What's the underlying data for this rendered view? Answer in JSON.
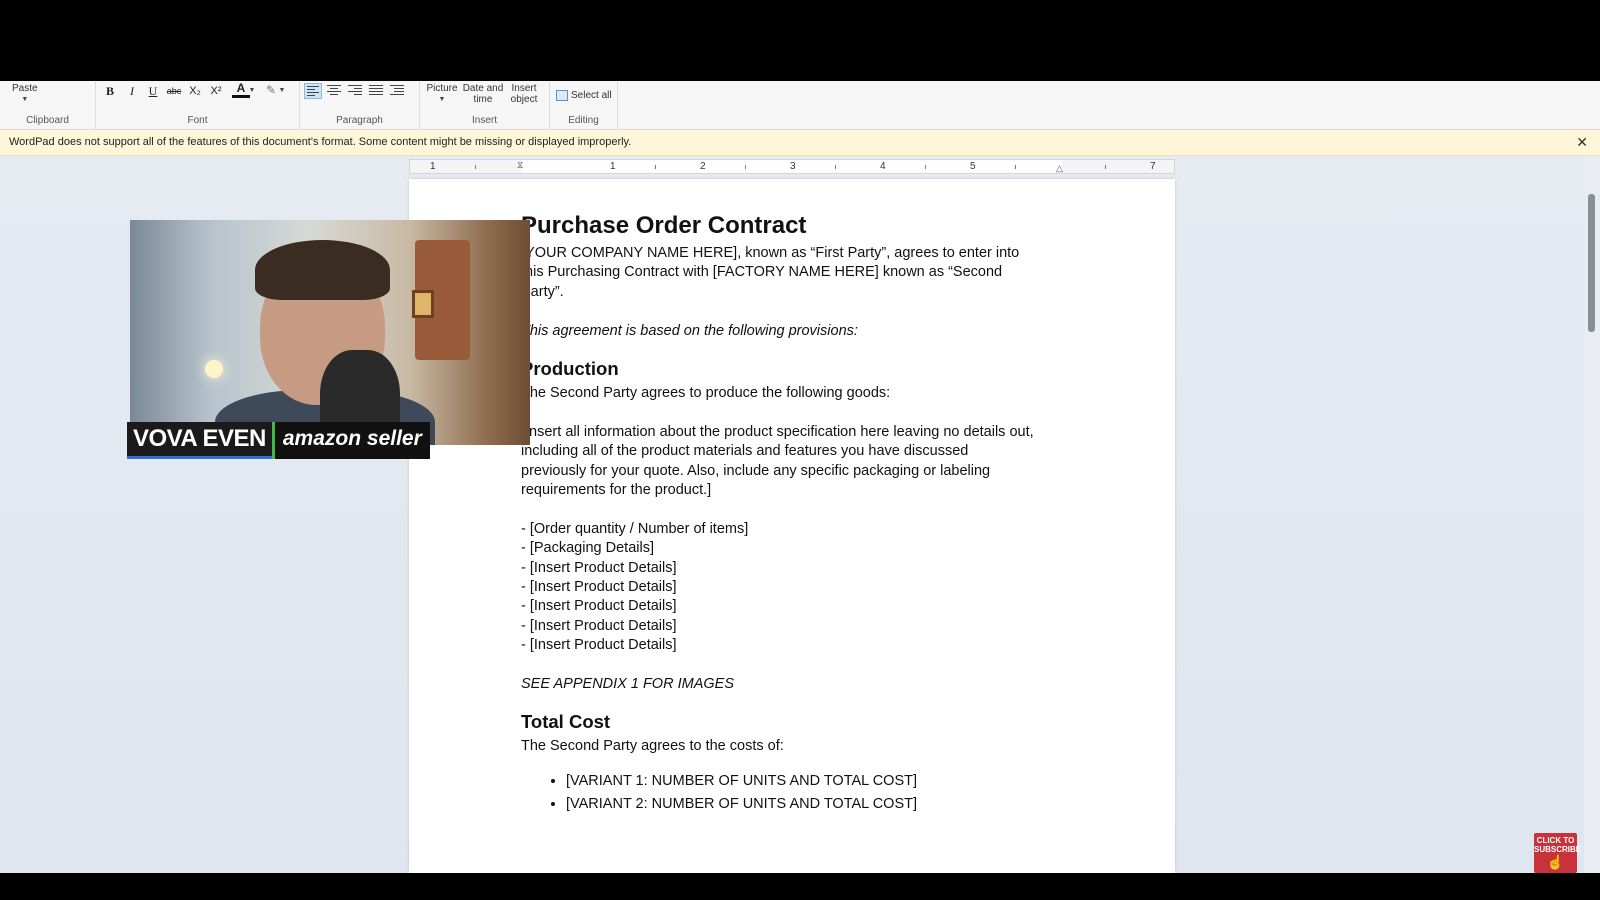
{
  "ribbon": {
    "clipboard": {
      "paste_label": "Paste",
      "group_label": "Clipboard"
    },
    "font": {
      "group_label": "Font",
      "bold": "B",
      "italic": "I",
      "underline": "U",
      "strike": "abc",
      "subscript": "X₂",
      "superscript": "X²",
      "font_color": "A",
      "highlight": "✎"
    },
    "paragraph": {
      "group_label": "Paragraph"
    },
    "insert": {
      "group_label": "Insert",
      "picture": "Picture",
      "datetime_line1": "Date and",
      "datetime_line2": "time",
      "object_line1": "Insert",
      "object_line2": "object"
    },
    "editing": {
      "group_label": "Editing",
      "select_all": "Select all"
    }
  },
  "infobar": {
    "message": "WordPad does not support all of the features of this document's format. Some content might be missing or displayed improperly.",
    "close": "✕"
  },
  "ruler": {
    "numbers": [
      "1",
      "1",
      "2",
      "3",
      "4",
      "5",
      "7"
    ]
  },
  "document": {
    "title": "Purchase Order Contract",
    "intro_1": "[YOUR COMPANY NAME HERE], known as “First Party”, agrees to enter into",
    "intro_2": "this Purchasing Contract with [FACTORY NAME HERE] known as “Second",
    "intro_3": "Party”.",
    "provisions": "This agreement is based on the following provisions:",
    "h_production": "Production",
    "production_intro": "The Second Party agrees to produce the following goods:",
    "spec_1": "[Insert all information about the product specification here leaving no details out,",
    "spec_2": "including all of the product materials and features you have discussed",
    "spec_3": "previously for your quote. Also, include any specific packaging or labeling",
    "spec_4": "requirements for the product.]",
    "items": [
      "- [Order quantity / Number of items]",
      "- [Packaging Details]",
      "- [Insert Product Details]",
      "- [Insert Product Details]",
      "- [Insert Product Details]",
      "- [Insert Product Details]",
      "- [Insert Product Details]"
    ],
    "appendix": "SEE APPENDIX 1 FOR IMAGES",
    "h_total": "Total Cost",
    "costs_intro": "The Second Party agrees to the costs of:",
    "variants": [
      "[VARIANT 1: NUMBER OF UNITS AND TOTAL COST]",
      "[VARIANT 2: NUMBER OF UNITS AND TOTAL COST]"
    ]
  },
  "overlay": {
    "name": "VOVA EVEN",
    "role": "amazon seller",
    "subscribe_line1": "CLICK TO",
    "subscribe_line2": "SUBSCRIBE",
    "brand_colors": {
      "name_underline": "#2d6fd8",
      "separator": "#46b84a",
      "subscribe": "#c8323a"
    }
  }
}
